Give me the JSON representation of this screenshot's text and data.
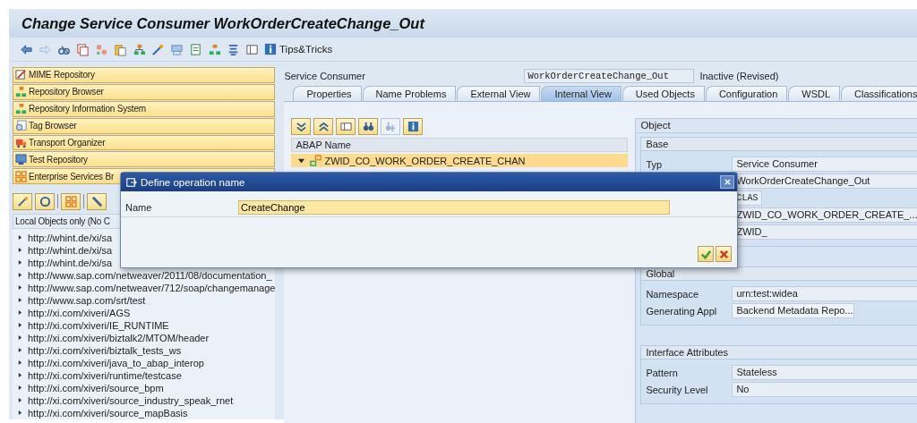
{
  "window": {
    "title": "Change Service Consumer WorkOrderCreateChange_Out"
  },
  "toolbar": {
    "tips_label": "Tips&Tricks"
  },
  "nav_buttons": [
    {
      "label": "MIME Repository"
    },
    {
      "label": "Repository Browser"
    },
    {
      "label": "Repository Information System"
    },
    {
      "label": "Tag Browser"
    },
    {
      "label": "Transport Organizer"
    },
    {
      "label": "Test Repository"
    },
    {
      "label": "Enterprise Services Br"
    }
  ],
  "object_list": {
    "header": "Local Objects only (No C",
    "items": [
      {
        "label": "http://whint.de/xi/sa"
      },
      {
        "label": "http://whint.de/xi/sa"
      },
      {
        "label": "http://whint.de/xi/sa"
      },
      {
        "label": "http://www.sap.com/netweaver/2011/08/documentation_"
      },
      {
        "label": "http://www.sap.com/netweaver/712/soap/changemanage"
      },
      {
        "label": "http://www.sap.com/srt/test"
      },
      {
        "label": "http://xi.com/xiveri/AGS"
      },
      {
        "label": "http://xi.com/xiveri/IE_RUNTIME"
      },
      {
        "label": "http://xi.com/xiveri/biztalk2/MTOM/header"
      },
      {
        "label": "http://xi.com/xiveri/biztalk_tests_ws"
      },
      {
        "label": "http://xi.com/xiveri/java_to_abap_interop"
      },
      {
        "label": "http://xi.com/xiveri/runtime/testcase"
      },
      {
        "label": "http://xi.com/xiveri/source_bpm"
      },
      {
        "label": "http://xi.com/xiveri/source_industry_speak_rnet"
      },
      {
        "label": "http://xi.com/xiveri/source_mapBasis"
      }
    ]
  },
  "header": {
    "label": "Service Consumer",
    "name": "WorkOrderCreateChange_Out",
    "status": "Inactive (Revised)"
  },
  "tabs": [
    {
      "label": "Properties",
      "selected": false
    },
    {
      "label": "Name Problems",
      "selected": false
    },
    {
      "label": "External View",
      "selected": false
    },
    {
      "label": "Internal View",
      "selected": true
    },
    {
      "label": "Used Objects",
      "selected": false
    },
    {
      "label": "Configuration",
      "selected": false
    },
    {
      "label": "WSDL",
      "selected": false
    },
    {
      "label": "Classifications",
      "selected": false
    }
  ],
  "tree": {
    "column": "ABAP Name",
    "rows": [
      {
        "label": "ZWID_CO_WORK_ORDER_CREATE_CHAN",
        "expanded": true,
        "selected": true
      }
    ]
  },
  "object_panel": {
    "title": "Object",
    "groups": [
      {
        "title": "Base",
        "fields": [
          {
            "label": "Typ",
            "value": "Service Consumer",
            "kind": "text"
          },
          {
            "value": "WorkOrderCreateChange_Out",
            "kind": "text"
          },
          {
            "value": "CLAS",
            "kind": "short"
          },
          {
            "value": "ZWID_CO_WORK_ORDER_CREATE_...",
            "kind": "text"
          },
          {
            "value": "ZWID_",
            "kind": "text"
          }
        ]
      },
      {
        "title": "Global",
        "fields": [
          {
            "label": "Namespace",
            "value": "urn:test:widea",
            "kind": "text"
          },
          {
            "label": "Generating Appl",
            "value": "Backend Metadata Repo...",
            "kind": "dropdown"
          }
        ]
      },
      {
        "title": "Interface Attributes",
        "fields": [
          {
            "label": "Pattern",
            "value": "Stateless",
            "kind": "text"
          },
          {
            "label": "Security Level",
            "value": "No",
            "kind": "text"
          }
        ]
      }
    ]
  },
  "dialog": {
    "title": "Define operation name",
    "label": "Name",
    "value": "CreateChange"
  }
}
